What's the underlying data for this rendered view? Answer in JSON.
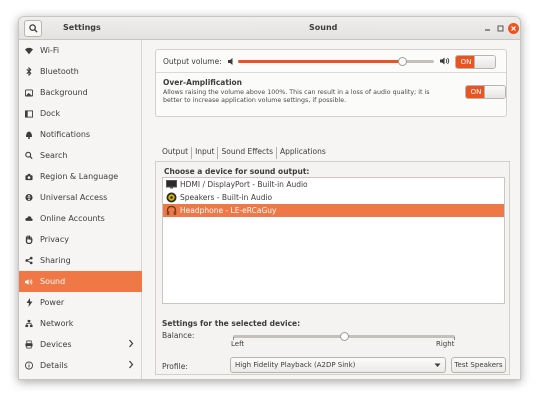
{
  "window": {
    "app_title": "Settings",
    "page_title": "Sound"
  },
  "sidebar": {
    "items": [
      {
        "label": "Wi-Fi",
        "icon": "wifi-icon"
      },
      {
        "label": "Bluetooth",
        "icon": "bluetooth-icon"
      },
      {
        "label": "Background",
        "icon": "background-icon"
      },
      {
        "label": "Dock",
        "icon": "dock-icon"
      },
      {
        "label": "Notifications",
        "icon": "bell-icon"
      },
      {
        "label": "Search",
        "icon": "search-icon"
      },
      {
        "label": "Region & Language",
        "icon": "camera-icon"
      },
      {
        "label": "Universal Access",
        "icon": "accessibility-icon"
      },
      {
        "label": "Online Accounts",
        "icon": "cloud-icon"
      },
      {
        "label": "Privacy",
        "icon": "hand-icon"
      },
      {
        "label": "Sharing",
        "icon": "share-icon"
      },
      {
        "label": "Sound",
        "icon": "speaker-icon",
        "active": true
      },
      {
        "label": "Power",
        "icon": "power-icon"
      },
      {
        "label": "Network",
        "icon": "network-icon"
      },
      {
        "label": "Devices",
        "icon": "printer-icon",
        "has_submenu": true
      },
      {
        "label": "Details",
        "icon": "info-icon",
        "has_submenu": true
      }
    ]
  },
  "sound": {
    "output_volume_label": "Output volume:",
    "output_volume_level": 0.84,
    "output_volume_toggle": "ON",
    "over_amp_title": "Over-Amplification",
    "over_amp_description": "Allows raising the volume above 100%. This can result in a loss of audio quality; it is better to increase application volume settings, if possible.",
    "over_amp_toggle": "ON",
    "tabs": [
      "Output",
      "Input",
      "Sound Effects",
      "Applications"
    ],
    "active_tab": "Output",
    "choose_device_label": "Choose a device for sound output:",
    "devices": [
      {
        "label": "HDMI / DisplayPort - Built-in Audio",
        "icon": "monitor-icon"
      },
      {
        "label": "Speakers - Built-in Audio",
        "icon": "speaker-device-icon"
      },
      {
        "label": "Headphone - LE-eRCaGuy",
        "icon": "headphone-icon",
        "selected": true
      }
    ],
    "settings_label": "Settings for the selected device:",
    "balance_label": "Balance:",
    "balance_value": 0.5,
    "balance_left": "Left",
    "balance_right": "Right",
    "profile_label": "Profile:",
    "profile_value": "High Fidelity Playback (A2DP Sink)",
    "test_speakers_label": "Test Speakers"
  },
  "colors": {
    "accent": "#e95420",
    "selection": "#f07746"
  }
}
